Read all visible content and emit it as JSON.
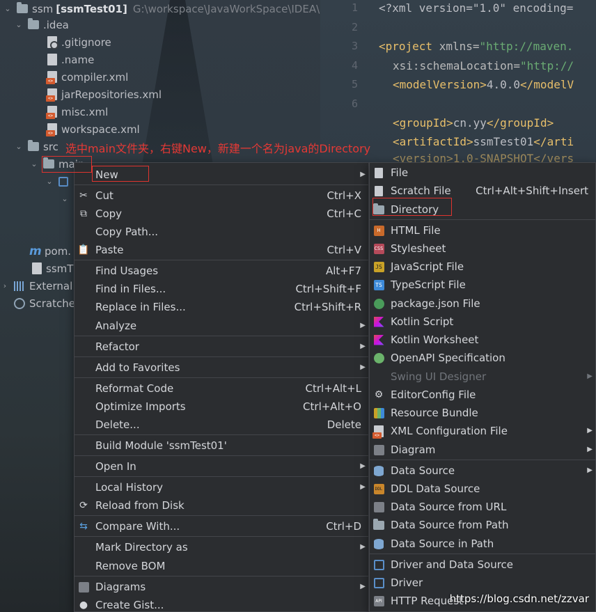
{
  "tree": {
    "root_name": "ssm",
    "root_module": "[ssmTest01]",
    "root_path": "G:\\workspace\\JavaWorkSpace\\IDEA\\ssm",
    "idea_folder": ".idea",
    "idea_files": [
      ".gitignore",
      ".name",
      "compiler.xml",
      "jarRepositories.xml",
      "misc.xml",
      "workspace.xml"
    ],
    "src_folder": "src",
    "main_folder": "main",
    "pom_file": "pom.",
    "iml_file": "ssmT",
    "external_libs": "External",
    "scratches": "Scratche",
    "annotation": "选中main文件夹，右键New，新建一个名为java的Directory"
  },
  "editor": {
    "line_numbers": [
      "1",
      "2",
      "3",
      "4",
      "5",
      "6"
    ],
    "line1": "<?xml version=\"1.0\" encoding=",
    "line3_tag": "<project",
    "line3_attr": " xmlns=",
    "line3_val": "\"http://maven.",
    "line4_attr": "xsi:schemaLocation=",
    "line4_val": "\"http://",
    "line5_open": "<modelVersion>",
    "line5_text": "4.0.0",
    "line5_close": "</modelV",
    "line7_open": "<groupId>",
    "line7_text": "cn.yy",
    "line7_close": "</groupId>",
    "line8_open": "<artifactId>",
    "line8_text": "ssmTest01",
    "line8_close": "</arti",
    "line9_partial": "<version>1.0-SNAPSHOT</vers"
  },
  "context_menu": {
    "items": [
      {
        "label": "New",
        "shortcut": "",
        "submenu": true
      },
      {
        "label": "Cut",
        "shortcut": "Ctrl+X",
        "submenu": false
      },
      {
        "label": "Copy",
        "shortcut": "Ctrl+C",
        "submenu": false
      },
      {
        "label": "Copy Path...",
        "shortcut": "",
        "submenu": false
      },
      {
        "label": "Paste",
        "shortcut": "Ctrl+V",
        "submenu": false
      },
      {
        "label": "Find Usages",
        "shortcut": "Alt+F7",
        "submenu": false
      },
      {
        "label": "Find in Files...",
        "shortcut": "Ctrl+Shift+F",
        "submenu": false
      },
      {
        "label": "Replace in Files...",
        "shortcut": "Ctrl+Shift+R",
        "submenu": false
      },
      {
        "label": "Analyze",
        "shortcut": "",
        "submenu": true
      },
      {
        "label": "Refactor",
        "shortcut": "",
        "submenu": true
      },
      {
        "label": "Add to Favorites",
        "shortcut": "",
        "submenu": true
      },
      {
        "label": "Reformat Code",
        "shortcut": "Ctrl+Alt+L",
        "submenu": false
      },
      {
        "label": "Optimize Imports",
        "shortcut": "Ctrl+Alt+O",
        "submenu": false
      },
      {
        "label": "Delete...",
        "shortcut": "Delete",
        "submenu": false
      },
      {
        "label": "Build Module 'ssmTest01'",
        "shortcut": "",
        "submenu": false
      },
      {
        "label": "Open In",
        "shortcut": "",
        "submenu": true
      },
      {
        "label": "Local History",
        "shortcut": "",
        "submenu": true
      },
      {
        "label": "Reload from Disk",
        "shortcut": "",
        "submenu": false
      },
      {
        "label": "Compare With...",
        "shortcut": "Ctrl+D",
        "submenu": false
      },
      {
        "label": "Mark Directory as",
        "shortcut": "",
        "submenu": true
      },
      {
        "label": "Remove BOM",
        "shortcut": "",
        "submenu": false
      },
      {
        "label": "Diagrams",
        "shortcut": "",
        "submenu": true
      },
      {
        "label": "Create Gist...",
        "shortcut": "",
        "submenu": false
      }
    ]
  },
  "new_submenu": {
    "items": [
      {
        "label": "File",
        "shortcut": "",
        "submenu": false,
        "enabled": true
      },
      {
        "label": "Scratch File",
        "shortcut": "Ctrl+Alt+Shift+Insert",
        "submenu": false,
        "enabled": true
      },
      {
        "label": "Directory",
        "shortcut": "",
        "submenu": false,
        "enabled": true
      },
      {
        "label": "HTML File",
        "shortcut": "",
        "submenu": false,
        "enabled": true
      },
      {
        "label": "Stylesheet",
        "shortcut": "",
        "submenu": false,
        "enabled": true
      },
      {
        "label": "JavaScript File",
        "shortcut": "",
        "submenu": false,
        "enabled": true
      },
      {
        "label": "TypeScript File",
        "shortcut": "",
        "submenu": false,
        "enabled": true
      },
      {
        "label": "package.json File",
        "shortcut": "",
        "submenu": false,
        "enabled": true
      },
      {
        "label": "Kotlin Script",
        "shortcut": "",
        "submenu": false,
        "enabled": true
      },
      {
        "label": "Kotlin Worksheet",
        "shortcut": "",
        "submenu": false,
        "enabled": true
      },
      {
        "label": "OpenAPI Specification",
        "shortcut": "",
        "submenu": false,
        "enabled": true
      },
      {
        "label": "Swing UI Designer",
        "shortcut": "",
        "submenu": true,
        "enabled": false
      },
      {
        "label": "EditorConfig File",
        "shortcut": "",
        "submenu": false,
        "enabled": true
      },
      {
        "label": "Resource Bundle",
        "shortcut": "",
        "submenu": false,
        "enabled": true
      },
      {
        "label": "XML Configuration File",
        "shortcut": "",
        "submenu": true,
        "enabled": true
      },
      {
        "label": "Diagram",
        "shortcut": "",
        "submenu": true,
        "enabled": true
      },
      {
        "label": "Data Source",
        "shortcut": "",
        "submenu": true,
        "enabled": true
      },
      {
        "label": "DDL Data Source",
        "shortcut": "",
        "submenu": false,
        "enabled": true
      },
      {
        "label": "Data Source from URL",
        "shortcut": "",
        "submenu": false,
        "enabled": true
      },
      {
        "label": "Data Source from Path",
        "shortcut": "",
        "submenu": false,
        "enabled": true
      },
      {
        "label": "Data Source in Path",
        "shortcut": "",
        "submenu": false,
        "enabled": true
      },
      {
        "label": "Driver and Data Source",
        "shortcut": "",
        "submenu": false,
        "enabled": true
      },
      {
        "label": "Driver",
        "shortcut": "",
        "submenu": false,
        "enabled": true
      },
      {
        "label": "HTTP Request",
        "shortcut": "",
        "submenu": false,
        "enabled": true
      }
    ]
  },
  "watermark": "https://blog.csdn.net/zzvar",
  "colors": {
    "menu_bg": "#2b2d30",
    "highlight_box": "#e0342f",
    "annotation_text": "#e53935",
    "xml_tag": "#e8bf6a",
    "xml_string": "#6aab73"
  }
}
